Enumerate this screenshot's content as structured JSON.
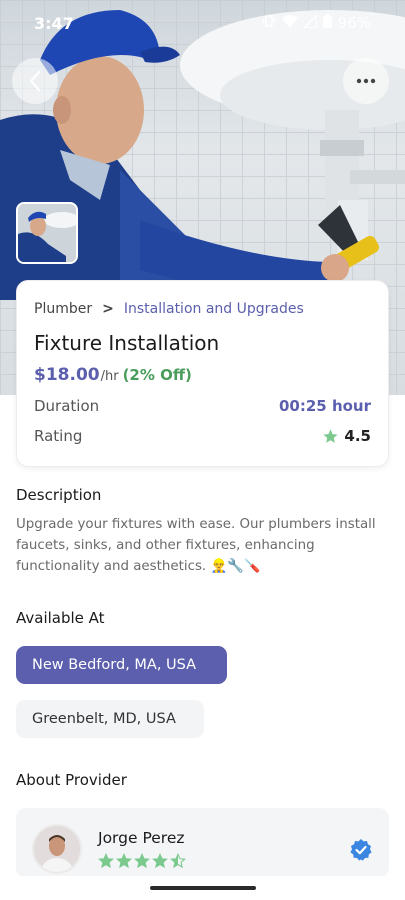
{
  "status_bar": {
    "time": "3:47",
    "battery": "96%"
  },
  "service": {
    "category": "Plumber",
    "separator": ">",
    "subcategory": "Installation and Upgrades",
    "title": "Fixture Installation",
    "price": "$18.00",
    "price_unit": "/hr",
    "discount": "(2% Off)",
    "duration_label": "Duration",
    "duration_value": "00:25 hour",
    "rating_label": "Rating",
    "rating_value": "4.5"
  },
  "description": {
    "title": "Description",
    "text": "Upgrade your fixtures with ease. Our plumbers install faucets, sinks, and other fixtures, enhancing functionality and aesthetics. 👷‍♂️🔧🪛"
  },
  "available": {
    "title": "Available At",
    "locations": [
      "New Bedford, MA, USA",
      "Greenbelt, MD, USA"
    ]
  },
  "provider": {
    "section_title": "About Provider",
    "name": "Jorge Perez",
    "rating": 4.5
  },
  "colors": {
    "accent": "#5b5fad",
    "discount": "#4a9d5c",
    "star": "#7cc98e",
    "verified": "#3a86e0"
  },
  "icons": {
    "back": "chevron-left-icon",
    "more": "more-horizontal-icon",
    "star": "star-icon",
    "verified": "verified-badge-icon"
  }
}
